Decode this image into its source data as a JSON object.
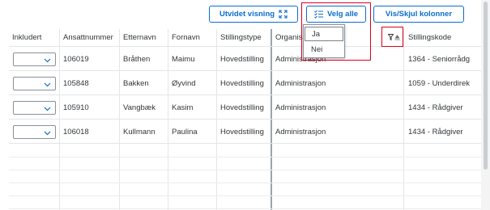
{
  "toolbar": {
    "expand_label": "Utvidet visning",
    "select_all_label": "Velg alle",
    "columns_label": "Vis/Skjul kolonner"
  },
  "dropdown": {
    "options": [
      "Ja",
      "Nei"
    ]
  },
  "table": {
    "columns": [
      "Inkludert",
      "Ansattnummer",
      "Etternavn",
      "Fornavn",
      "Stillingstype",
      "Organisas",
      "Stillingskode"
    ],
    "rows": [
      {
        "ansattnummer": "106019",
        "etternavn": "Bråthen",
        "fornavn": "Maimu",
        "stillingstype": "Hovedstilling",
        "organisasjon": "Administrasjon",
        "stillingskode": "1364 - Seniorrådg"
      },
      {
        "ansattnummer": "105848",
        "etternavn": "Bakken",
        "fornavn": "Øyvind",
        "stillingstype": "Hovedstilling",
        "organisasjon": "Administrasjon",
        "stillingskode": "1059 - Underdirek"
      },
      {
        "ansattnummer": "105910",
        "etternavn": "Vangbæk",
        "fornavn": "Kasim",
        "stillingstype": "Hovedstilling",
        "organisasjon": "Administrasjon",
        "stillingskode": "1434 - Rådgiver"
      },
      {
        "ansattnummer": "106018",
        "etternavn": "Kullmann",
        "fornavn": "Paulina",
        "stillingstype": "Hovedstilling",
        "organisasjon": "Administrasjon",
        "stillingskode": "1434 - Rådgiver"
      }
    ]
  },
  "colors": {
    "accent": "#0a6ed1",
    "highlight": "#e0001b",
    "grid_line": "#e5e5e5",
    "text": "#32363a"
  },
  "icons": {
    "expand": "expand-arrows-icon",
    "select_all": "checklist-icon",
    "filter": "filter-icon",
    "sort": "sort-ascending-icon",
    "dropdown": "chevron-down-icon"
  }
}
